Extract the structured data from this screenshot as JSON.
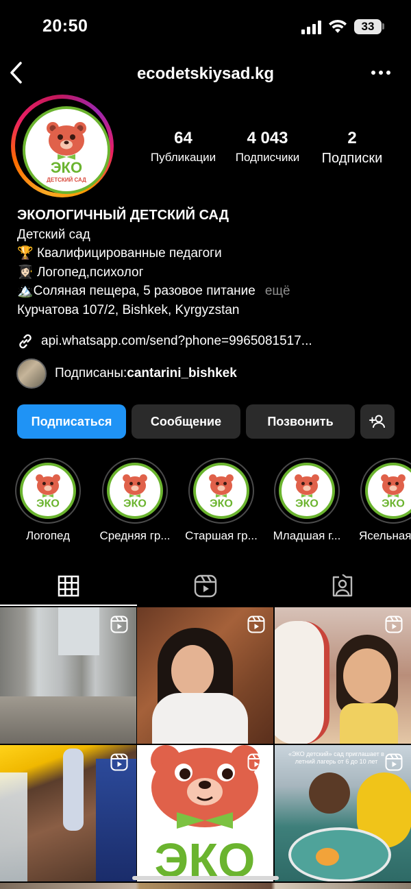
{
  "status_bar": {
    "time": "20:50",
    "battery": "33"
  },
  "header": {
    "username": "ecodetskiysad.kg"
  },
  "stats": [
    {
      "value": "64",
      "label": "Публикации"
    },
    {
      "value": "4 043",
      "label": "Подписчики"
    },
    {
      "value": "2",
      "label": "Подписки"
    }
  ],
  "bio": {
    "name": "ЭКОЛОГИЧНЫЙ ДЕТСКИЙ САД",
    "category": "Детский сад",
    "lines": [
      {
        "emoji": "🏆",
        "text": " Квалифицированные педагоги"
      },
      {
        "emoji": "👩🏻‍🎓",
        "text": " Логопед,психолог"
      },
      {
        "emoji": "🏔️",
        "text": "Соляная пещера, 5 разовое питание"
      }
    ],
    "more": "ещё",
    "address": "Курчатова 107/2, Bishkek, Kyrgyzstan"
  },
  "link": "api.whatsapp.com/send?phone=9965081517...",
  "followed_by": {
    "prefix": "Подписаны: ",
    "name": "cantarini_bishkek"
  },
  "buttons": {
    "follow": "Подписаться",
    "message": "Сообщение",
    "call": "Позвонить"
  },
  "highlights": [
    {
      "label": "Логопед"
    },
    {
      "label": "Средняя гр..."
    },
    {
      "label": "Старшая гр..."
    },
    {
      "label": "Младшая г..."
    },
    {
      "label": "Ясельная"
    }
  ],
  "logo": {
    "top": "ЭКО",
    "bottom": "ДЕТСКИЙ САД"
  },
  "grid": {
    "posts": [
      {
        "type": "reel"
      },
      {
        "type": "reel"
      },
      {
        "type": "reel"
      },
      {
        "type": "reel"
      },
      {
        "type": "reel"
      },
      {
        "type": "reel",
        "caption": "«ЭКО детский» сад приглашает в летний лагерь от 6 до 10 лет"
      }
    ]
  },
  "colors": {
    "accent": "#1f93f5",
    "logo_green": "#6bb42f",
    "logo_bear": "#e0614a"
  }
}
